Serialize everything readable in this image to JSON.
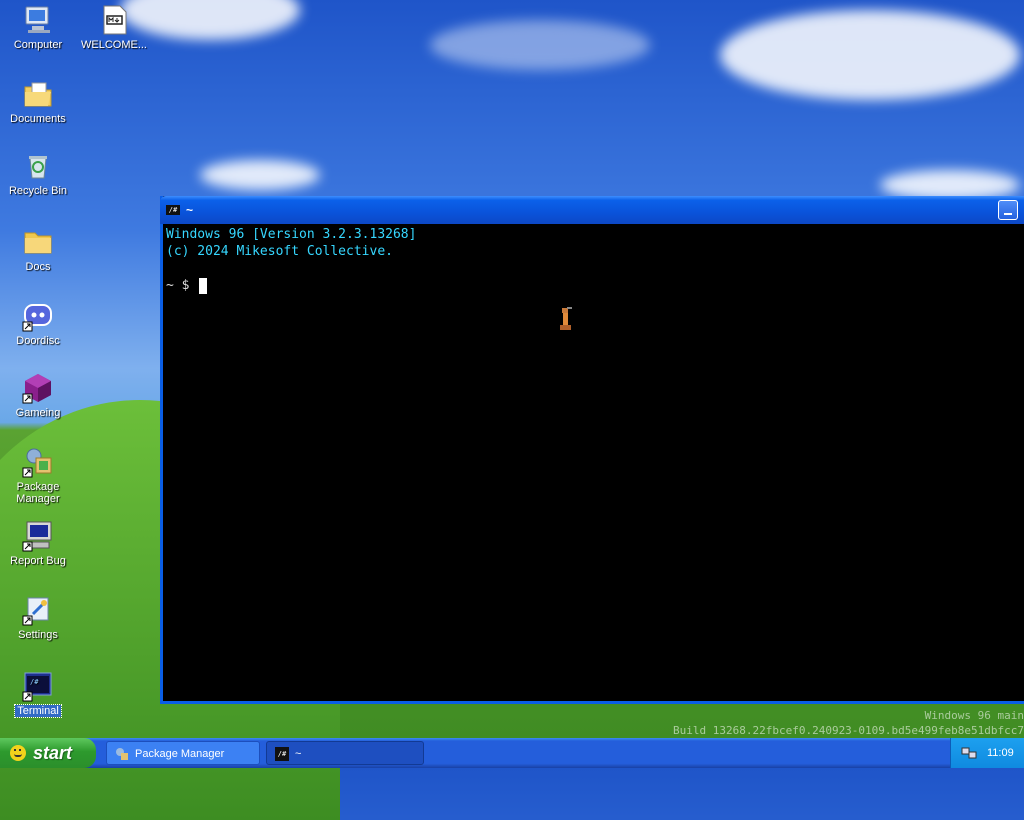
{
  "desktop": {
    "icons": [
      {
        "label": "Computer",
        "icon": "computer-icon"
      },
      {
        "label": "WELCOME...",
        "icon": "markdown-file-icon"
      },
      {
        "label": "Documents",
        "icon": "documents-folder-icon"
      },
      {
        "label": "Recycle Bin",
        "icon": "recycle-bin-icon"
      },
      {
        "label": "Docs",
        "icon": "folder-icon"
      },
      {
        "label": "Doordisc",
        "icon": "doordisc-icon"
      },
      {
        "label": "Gameing",
        "icon": "gaming-cube-icon"
      },
      {
        "label": "Package Manager",
        "icon": "package-manager-icon"
      },
      {
        "label": "Report Bug",
        "icon": "report-bug-icon"
      },
      {
        "label": "Settings",
        "icon": "settings-icon"
      },
      {
        "label": "Terminal",
        "icon": "terminal-icon"
      }
    ],
    "watermark": {
      "line1": "Windows 96 main",
      "line2": "Build 13268.22fbcef0.240923-0109.bd5e499feb8e51dbfcc7"
    }
  },
  "terminal_window": {
    "title": "~",
    "icon_text": "/#",
    "output_lines": [
      "Windows 96 [Version 3.2.3.13268]",
      "(c) 2024 Mikesoft Collective."
    ],
    "prompt": "~ $"
  },
  "taskbar": {
    "start_label": "start",
    "tasks": [
      {
        "label": "Package Manager",
        "icon": "package-manager-icon",
        "active": false
      },
      {
        "label": "~",
        "icon": "terminal-icon",
        "active": true
      }
    ],
    "clock": "11:09"
  },
  "colors": {
    "terminal_text": "#36d7ff",
    "titlebar_blue": "#0a53da",
    "taskbar_blue": "#245edb",
    "start_green": "#2d9a2d"
  }
}
